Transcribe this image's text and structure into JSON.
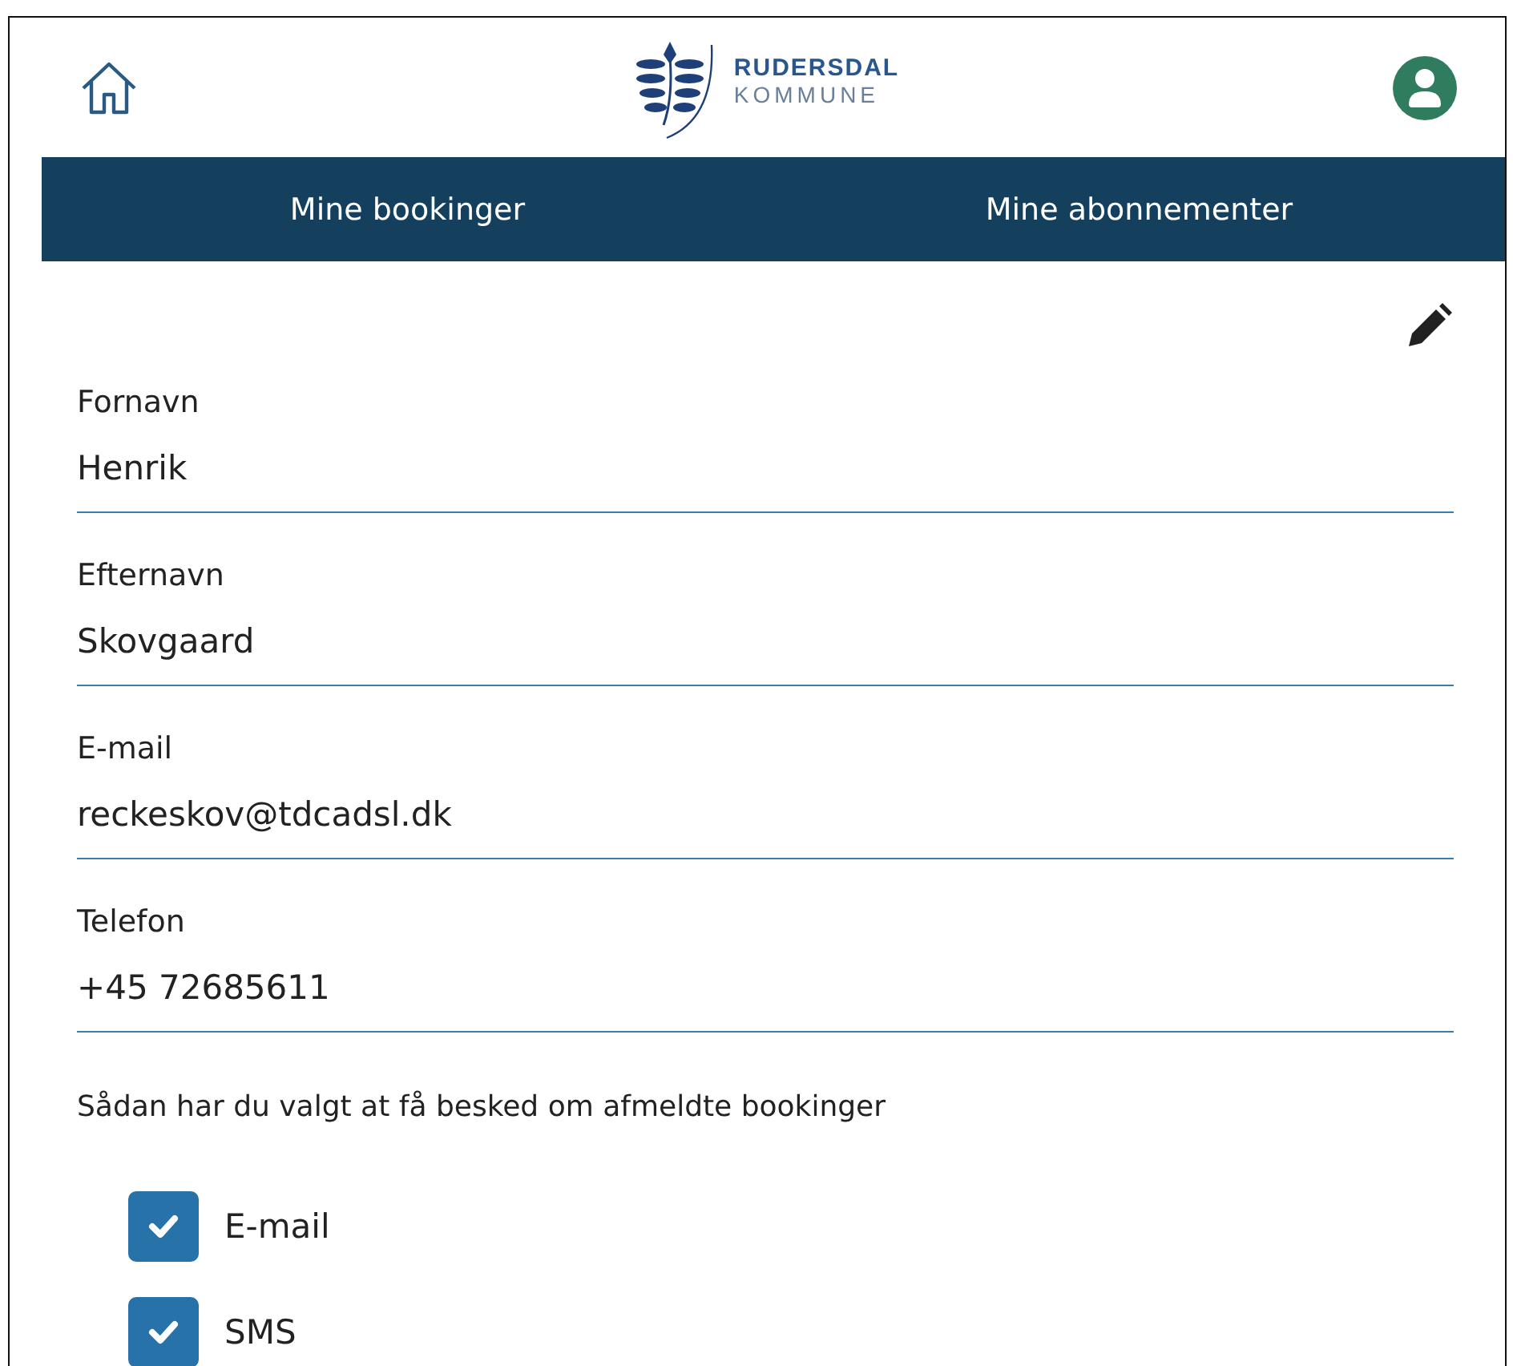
{
  "header": {
    "logo": {
      "line_1": "RUDERSDAL",
      "line_2": "KOMMUNE"
    }
  },
  "nav": [
    {
      "label": "Mine bookinger"
    },
    {
      "label": "Mine abonnementer"
    }
  ],
  "fields": [
    {
      "label": "Fornavn",
      "value": "Henrik"
    },
    {
      "label": "Efternavn",
      "value": "Skovgaard"
    },
    {
      "label": "E-mail",
      "value": "reckeskov@tdcadsl.dk"
    },
    {
      "label": "Telefon",
      "value": "+45 72685611"
    }
  ],
  "notification": {
    "text": "Sådan har du valgt at få besked om afmeldte bookinger",
    "options": [
      {
        "label": "E-mail",
        "checked": true
      },
      {
        "label": "SMS",
        "checked": true
      }
    ]
  }
}
